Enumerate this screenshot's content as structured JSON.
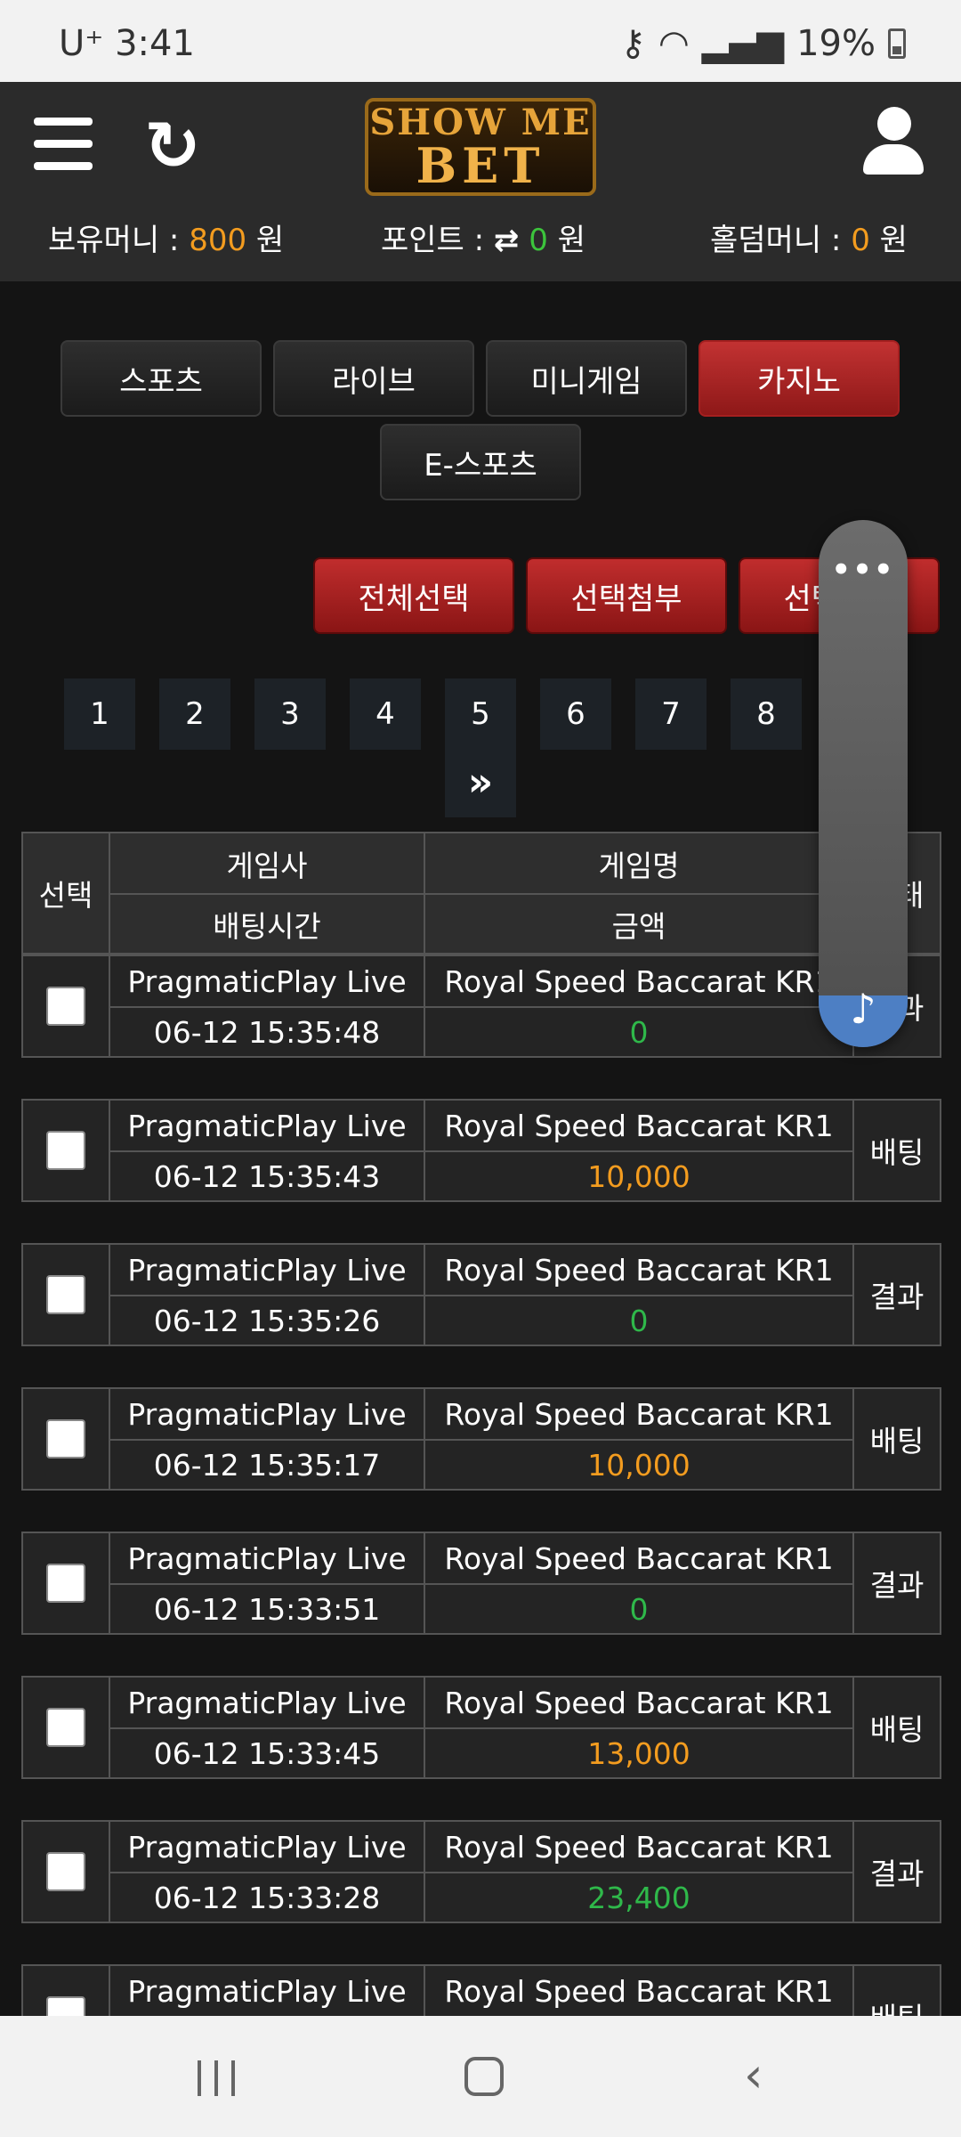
{
  "status": {
    "carrier": "U⁺",
    "time": "3:41",
    "battery": "19%"
  },
  "header": {
    "logo_top": "SHOW ME",
    "logo_bottom": "BET",
    "balance_label": "보유머니 :",
    "balance_value": "800",
    "points_label": "포인트 :",
    "points_value": "0",
    "holdem_label": "홀덤머니 :",
    "holdem_value": "0",
    "unit": "원"
  },
  "tabs": [
    {
      "label": "스포츠",
      "active": false
    },
    {
      "label": "라이브",
      "active": false
    },
    {
      "label": "미니게임",
      "active": false
    },
    {
      "label": "카지노",
      "active": true
    },
    {
      "label": "E-스포츠",
      "active": false
    }
  ],
  "actions": {
    "select_all": "전체선택",
    "attach_selected": "선택첨부",
    "third": "선택삭제"
  },
  "pagination": {
    "pages": [
      "1",
      "2",
      "3",
      "4",
      "5",
      "6",
      "7",
      "8"
    ],
    "next": "»"
  },
  "table": {
    "headers": {
      "select": "선택",
      "provider": "게임사",
      "game": "게임명",
      "bet_time": "배팅시간",
      "amount": "금액",
      "status": "상태"
    },
    "rows": [
      {
        "provider": "PragmaticPlay Live",
        "game": "Royal Speed Baccarat KR1",
        "time": "06-12 15:35:48",
        "amount": "0",
        "amount_color": "green",
        "status": "결과"
      },
      {
        "provider": "PragmaticPlay Live",
        "game": "Royal Speed Baccarat KR1",
        "time": "06-12 15:35:43",
        "amount": "10,000",
        "amount_color": "orange",
        "status": "배팅"
      },
      {
        "provider": "PragmaticPlay Live",
        "game": "Royal Speed Baccarat KR1",
        "time": "06-12 15:35:26",
        "amount": "0",
        "amount_color": "green",
        "status": "결과"
      },
      {
        "provider": "PragmaticPlay Live",
        "game": "Royal Speed Baccarat KR1",
        "time": "06-12 15:35:17",
        "amount": "10,000",
        "amount_color": "orange",
        "status": "배팅"
      },
      {
        "provider": "PragmaticPlay Live",
        "game": "Royal Speed Baccarat KR1",
        "time": "06-12 15:33:51",
        "amount": "0",
        "amount_color": "green",
        "status": "결과"
      },
      {
        "provider": "PragmaticPlay Live",
        "game": "Royal Speed Baccarat KR1",
        "time": "06-12 15:33:45",
        "amount": "13,000",
        "amount_color": "orange",
        "status": "배팅"
      },
      {
        "provider": "PragmaticPlay Live",
        "game": "Royal Speed Baccarat KR1",
        "time": "06-12 15:33:28",
        "amount": "23,400",
        "amount_color": "green",
        "status": "결과"
      },
      {
        "provider": "PragmaticPlay Live",
        "game": "Royal Speed Baccarat KR1",
        "time": "",
        "amount": "",
        "amount_color": "orange",
        "status": "배팅"
      }
    ]
  },
  "floating": {
    "menu": "•••",
    "note": "♪"
  },
  "colors": {
    "accent_red": "#c23232",
    "amount_orange": "#f39c1f",
    "amount_green": "#2fb84a"
  }
}
